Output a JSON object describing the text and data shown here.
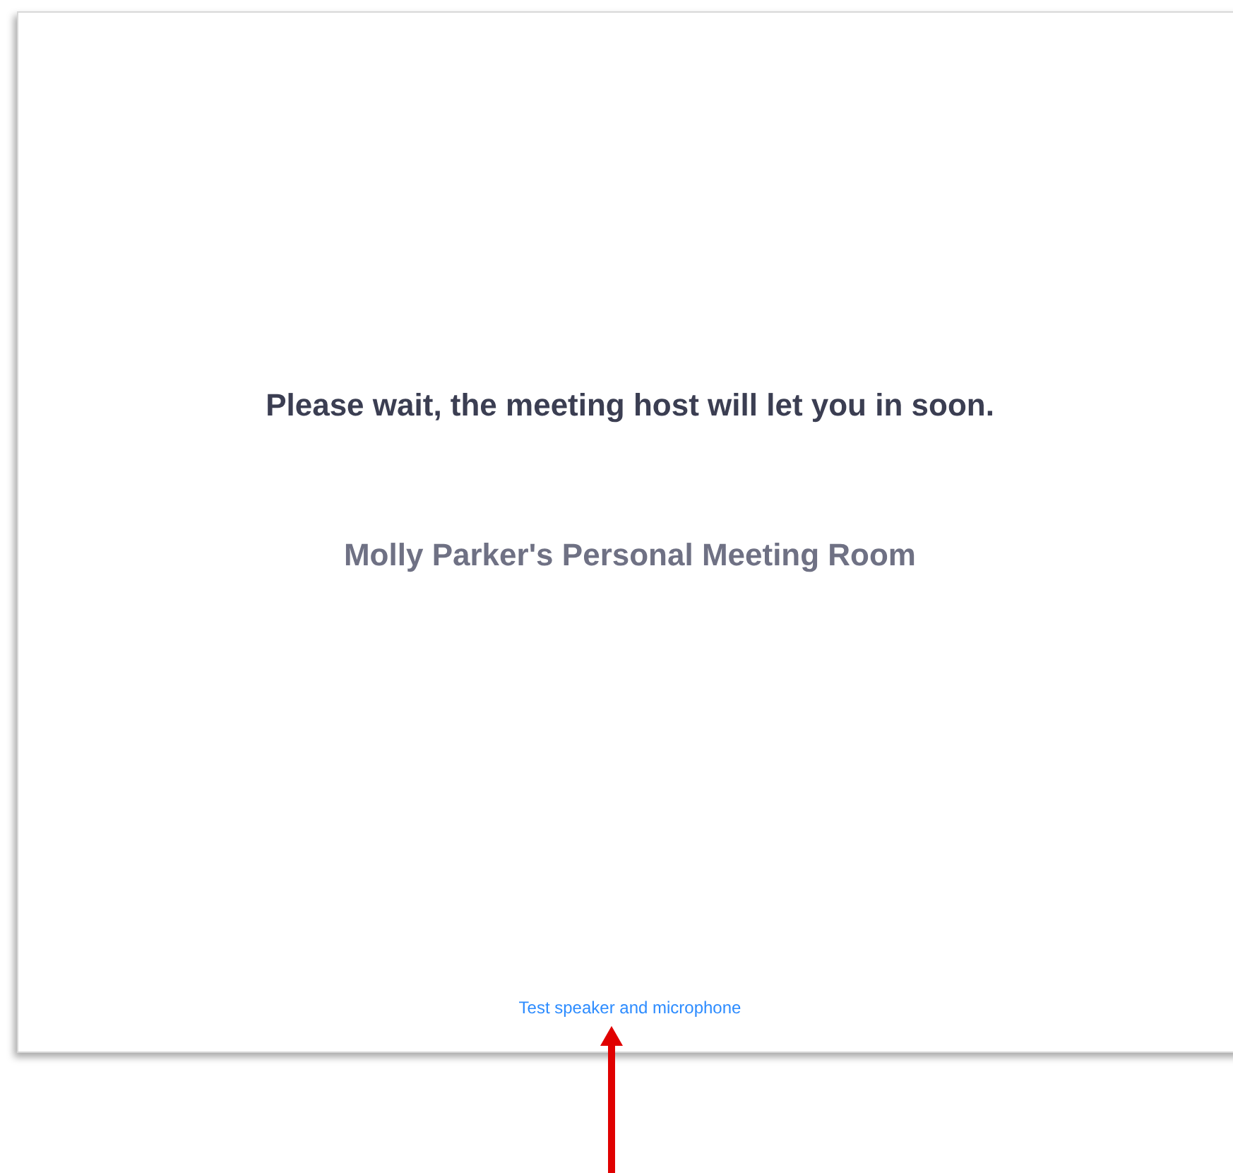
{
  "waiting_message": "Please wait, the meeting host will let you in soon.",
  "meeting_name": "Molly Parker's Personal Meeting Room",
  "test_link": "Test speaker and microphone"
}
